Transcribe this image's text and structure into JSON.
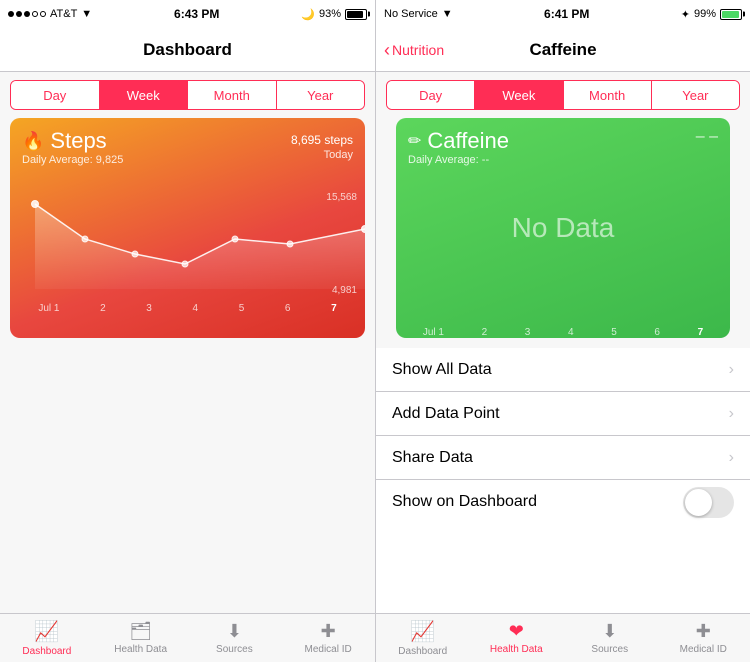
{
  "left": {
    "statusBar": {
      "carrier": "AT&T",
      "time": "6:43 PM",
      "batteryPercent": "93%",
      "wifiIcon": "📶"
    },
    "navTitle": "Dashboard",
    "segmentControl": {
      "items": [
        "Day",
        "Week",
        "Month",
        "Year"
      ],
      "activeIndex": 1
    },
    "stepsCard": {
      "icon": "🔥",
      "title": "Steps",
      "subtitle": "Daily Average: 9,825",
      "value": "8,695",
      "unit": " steps",
      "date": "Today",
      "yHigh": "15,568",
      "yLow": "4,981",
      "xLabels": [
        "Jul 1",
        "2",
        "3",
        "4",
        "5",
        "6",
        "7"
      ]
    },
    "tabBar": {
      "items": [
        {
          "icon": "📈",
          "label": "Dashboard",
          "active": true
        },
        {
          "icon": "❤️",
          "label": "Health Data",
          "active": false
        },
        {
          "icon": "⬇",
          "label": "Sources",
          "active": false
        },
        {
          "icon": "✚",
          "label": "Medical ID",
          "active": false
        }
      ]
    }
  },
  "right": {
    "statusBar": {
      "carrier": "No Service",
      "time": "6:41 PM",
      "batteryPercent": "99%"
    },
    "navBack": "Nutrition",
    "navTitle": "Caffeine",
    "segmentControl": {
      "items": [
        "Day",
        "Week",
        "Month",
        "Year"
      ],
      "activeIndex": 1
    },
    "caffeineCard": {
      "icon": "✏️",
      "title": "Caffeine",
      "subtitle": "Daily Average: --",
      "noData": "No Data",
      "xLabels": [
        "Jul 1",
        "2",
        "3",
        "4",
        "5",
        "6",
        "7"
      ]
    },
    "menuItems": [
      {
        "label": "Show All Data",
        "type": "chevron"
      },
      {
        "label": "Add Data Point",
        "type": "chevron"
      },
      {
        "label": "Share Data",
        "type": "chevron"
      },
      {
        "label": "Show on Dashboard",
        "type": "toggle"
      }
    ],
    "tabBar": {
      "items": [
        {
          "icon": "📈",
          "label": "Dashboard",
          "active": false
        },
        {
          "icon": "❤️",
          "label": "Health Data",
          "active": true
        },
        {
          "icon": "⬇",
          "label": "Sources",
          "active": false
        },
        {
          "icon": "✚",
          "label": "Medical ID",
          "active": false
        }
      ]
    }
  }
}
